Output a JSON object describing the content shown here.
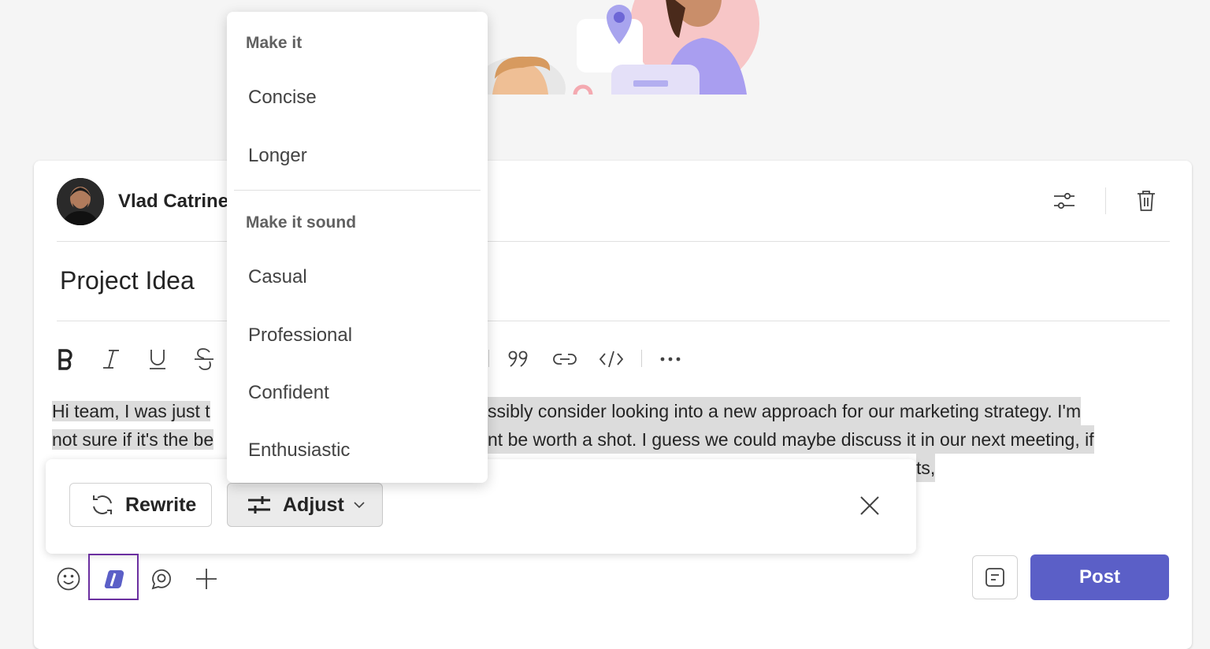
{
  "post": {
    "author_name": "Vlad Catrine",
    "subject": "Project Idea",
    "message_line1_a": "Hi team,  I was just t",
    "message_line1_b": "ssibly consider looking into a new approach for our marketing strategy. I'm",
    "message_line2_a": "not sure if it's the be",
    "message_line2_b": "nt be worth a shot. I guess we could maybe discuss it in our next meeting, if",
    "message_line3_tail": "ts,",
    "post_label": "Post"
  },
  "copilot": {
    "rewrite_label": "Rewrite",
    "adjust_label": "Adjust"
  },
  "adjust_menu": {
    "section1_title": "Make it",
    "section1_items": [
      "Concise",
      "Longer"
    ],
    "section2_title": "Make it sound",
    "section2_items": [
      "Casual",
      "Professional",
      "Confident",
      "Enthusiastic"
    ]
  },
  "icons": {
    "toolbar": [
      "bold-icon",
      "italic-icon",
      "underline-icon",
      "strikethrough-icon",
      "quote-icon",
      "link-icon",
      "code-icon",
      "more-icon"
    ],
    "header": [
      "settings-sliders-icon",
      "delete-icon"
    ],
    "bottom": [
      "emoji-icon",
      "copilot-icon",
      "loop-icon",
      "add-icon",
      "schedule-icon"
    ]
  },
  "colors": {
    "accent": "#5b5fc7",
    "focus_outline": "#6b2fa0",
    "highlight": "#dcdcdc"
  }
}
